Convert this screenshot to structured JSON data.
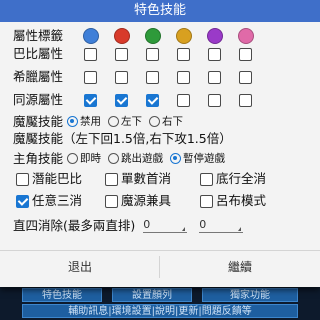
{
  "dialog": {
    "title": "特色技能",
    "attr_label": "屬性標籤",
    "attr_icons": [
      {
        "name": "water-element-icon",
        "color": "#3f7fd8"
      },
      {
        "name": "fire-element-icon",
        "color": "#d83a2a"
      },
      {
        "name": "wood-element-icon",
        "color": "#2e9a3a"
      },
      {
        "name": "light-element-icon",
        "color": "#d8a020"
      },
      {
        "name": "dark-element-icon",
        "color": "#9a3ac8"
      },
      {
        "name": "heart-element-icon",
        "color": "#e06aa8"
      }
    ],
    "rows": [
      {
        "label": "巴比屬性",
        "checks": [
          false,
          false,
          false,
          false,
          false,
          false
        ]
      },
      {
        "label": "希臘屬性",
        "checks": [
          false,
          false,
          false,
          false,
          false,
          false
        ]
      },
      {
        "label": "同源屬性",
        "checks": [
          true,
          true,
          true,
          false,
          false,
          false
        ]
      }
    ],
    "demon_skill": {
      "label": "魔魘技能",
      "opts": [
        "禁用",
        "左下",
        "右下"
      ],
      "selected": 0
    },
    "demon_skill_desc": "魔魘技能（左下回1.5倍,右下攻1.5倍）",
    "hero_skill": {
      "label": "主角技能",
      "opts": [
        "即時",
        "跳出遊戲",
        "暫停遊戲"
      ],
      "selected": 2
    },
    "options": [
      {
        "label": "潛能巴比",
        "checked": false
      },
      {
        "label": "單數首消",
        "checked": false
      },
      {
        "label": "底行全消",
        "checked": false
      },
      {
        "label": "任意三消",
        "checked": true
      },
      {
        "label": "魔源兼具",
        "checked": false
      },
      {
        "label": "呂布模式",
        "checked": false
      }
    ],
    "straight_clear": {
      "label": "直四消除(最多兩直排)",
      "value1": "0",
      "value2": "0"
    },
    "exit_label": "退出",
    "continue_label": "繼續"
  },
  "background": {
    "row1": [
      "特色技能",
      "設置顏列",
      "獨家功能"
    ],
    "row2": "輔助訊息|環境設置|說明|更新|問題反饋等"
  }
}
